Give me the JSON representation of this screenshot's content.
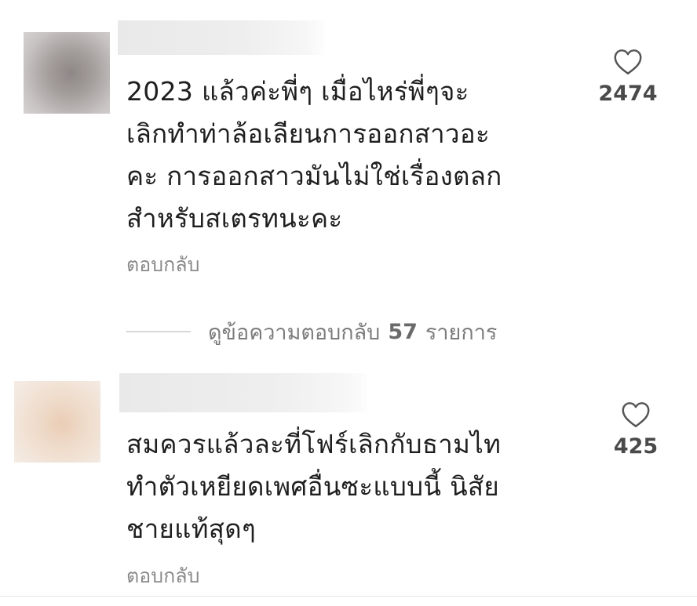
{
  "comments": [
    {
      "text_lines": [
        "2023 แล้วค่ะพี่ๆ เมื่อไหร่พี่ๆจะ",
        "เลิกทำท่าล้อเลียนการออกสาวอะ",
        "คะ การออกสาวมันไม่ใช่เรื่องตลก",
        "สำหรับสเตรทนะคะ"
      ],
      "reply_label": "ตอบกลับ",
      "like_count": "2474",
      "like_icon": "heart-outline-icon"
    },
    {
      "text_lines": [
        "สมควรแล้วละที่โฟร์เลิกกับธามไท",
        "ทำตัวเหยียดเพศอื่นซะแบบนี้ นิสัย",
        "ชายแท้สุดๆ"
      ],
      "reply_label": "ตอบกลับ",
      "like_count": "425",
      "like_icon": "heart-outline-icon"
    }
  ],
  "view_replies": {
    "prefix": "ดูข้อความตอบกลับ",
    "count": "57",
    "suffix": "รายการ"
  },
  "colors": {
    "text": "#1f1f1f",
    "muted": "#8a8a8a",
    "like_count": "#4a4a4a"
  }
}
